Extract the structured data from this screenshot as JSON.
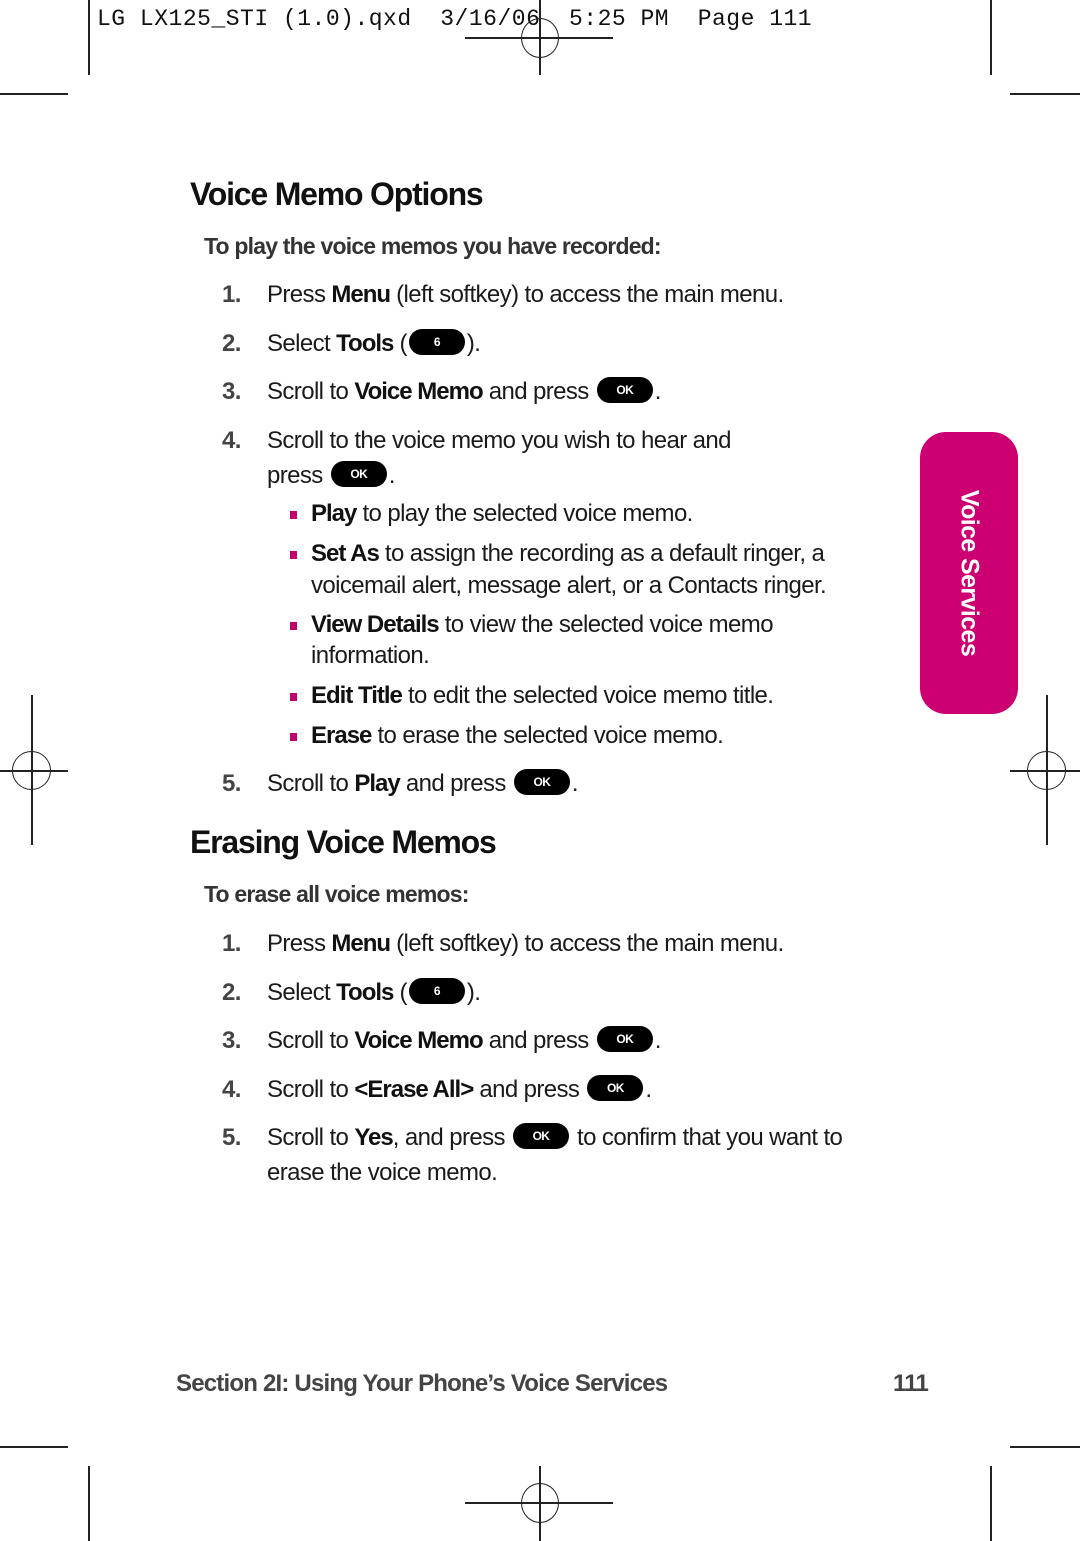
{
  "slug": "LG LX125_STI (1.0).qxd  3/16/06  5:25 PM  Page 111",
  "section1": {
    "title": "Voice Memo Options",
    "subtitle": "To play the voice memos you have recorded:",
    "steps": [
      {
        "num": "1.",
        "pre": "Press ",
        "bold": "Menu",
        "post": " (left softkey) to access the main menu."
      },
      {
        "num": "2.",
        "pre": "Select ",
        "bold": "Tools",
        "mid": " (",
        "key": "6",
        "post": ")."
      },
      {
        "num": "3.",
        "pre": "Scroll to ",
        "bold": "Voice Memo",
        "mid": " and press ",
        "key": "OK",
        "post": "."
      },
      {
        "num": "4.",
        "line1": "Scroll to the voice memo you wish to hear and",
        "pre": "press ",
        "key": "OK",
        "post": "."
      },
      {
        "num": "5.",
        "pre": "Scroll to ",
        "bold": "Play",
        "mid": " and press ",
        "key": "OK",
        "post": "."
      }
    ],
    "bullets": [
      {
        "bold": "Play",
        "text": " to play the selected voice memo."
      },
      {
        "bold": "Set As",
        "text": "  to assign the recording as a default ringer, a",
        "line2": "voicemail alert, message alert, or a Contacts ringer."
      },
      {
        "bold": "View Details",
        "text": " to view the selected voice memo",
        "line2": "information."
      },
      {
        "bold": "Edit Title",
        "text": " to edit the selected voice memo title."
      },
      {
        "bold": "Erase",
        "text": " to erase the selected voice memo."
      }
    ]
  },
  "section2": {
    "title": "Erasing Voice Memos",
    "subtitle": "To erase all voice memos:",
    "steps": [
      {
        "num": "1.",
        "pre": "Press ",
        "bold": "Menu",
        "post": " (left softkey) to access the main menu."
      },
      {
        "num": "2.",
        "pre": "Select ",
        "bold": "Tools",
        "mid": " (",
        "key": "6",
        "post": ")."
      },
      {
        "num": "3.",
        "pre": "Scroll to ",
        "bold": "Voice Memo",
        "mid": " and press ",
        "key": "OK",
        "post": "."
      },
      {
        "num": "4.",
        "pre": "Scroll to ",
        "bold": "<Erase All>",
        "mid": " and press ",
        "key": "OK",
        "post": "."
      },
      {
        "num": "5.",
        "pre": "Scroll to ",
        "bold": "Yes",
        "mid": ", and press ",
        "key": "OK",
        "post": " to confirm that you want to",
        "line2": "erase the voice memo."
      }
    ]
  },
  "side_tab": {
    "label": "Voice Services",
    "color": "#cc0070"
  },
  "footer": {
    "section": "Section 2I: Using Your Phone’s Voice Services",
    "page": "111"
  },
  "colors": {
    "accent": "#cc0070",
    "bullet": "#c2006b"
  }
}
